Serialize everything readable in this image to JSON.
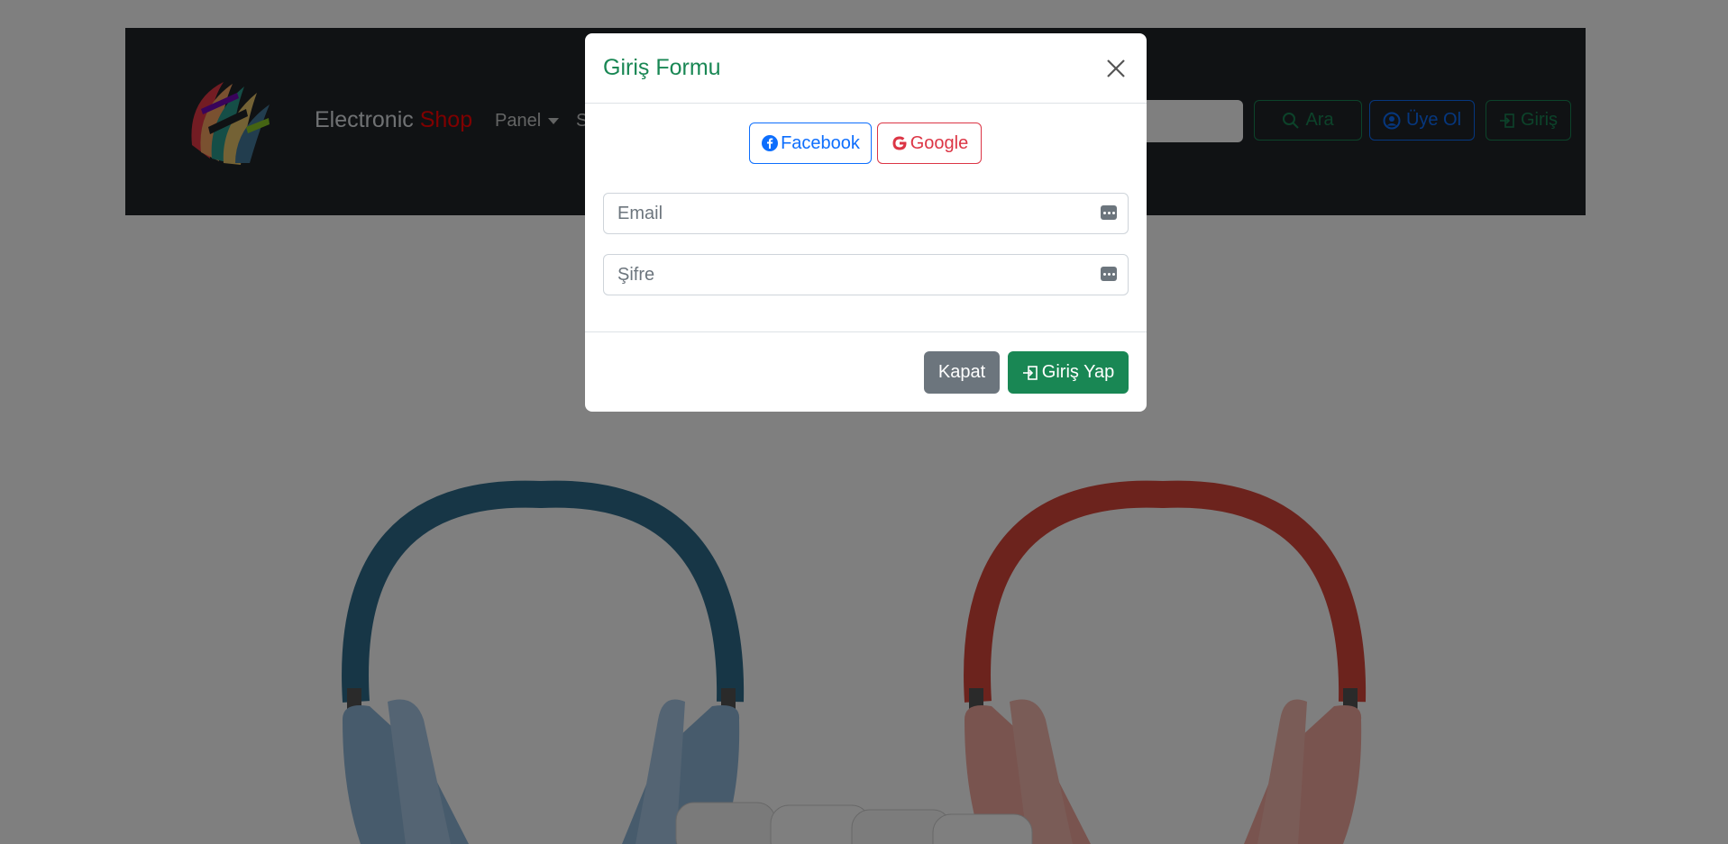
{
  "navbar": {
    "brand_prefix": "Electronic",
    "brand_accent": "Shop",
    "menu_panel": "Panel",
    "menu_partial": "S",
    "search_button": "Ara",
    "register_button": "Üye Ol",
    "login_button": "Giriş"
  },
  "modal": {
    "title": "Giriş Formu",
    "facebook_label": "Facebook",
    "google_label": "Google",
    "email_placeholder": "Email",
    "password_placeholder": "Şifre",
    "close_button": "Kapat",
    "submit_button": "Giriş Yap"
  },
  "colors": {
    "navbar_bg": "#212529",
    "brand_accent": "#ff0000",
    "success": "#198754",
    "primary": "#0d6efd",
    "danger": "#dc3545",
    "secondary": "#6c757d",
    "headphone_left": "#2f6d8d",
    "headphone_right": "#d9463a"
  },
  "icons": {
    "search_button": "search-icon",
    "register_button": "user-circle-icon",
    "login_button": "login-icon",
    "close": "close-icon",
    "facebook": "facebook-icon",
    "google": "google-icon",
    "input_fields": "password-manager-key-icon"
  }
}
